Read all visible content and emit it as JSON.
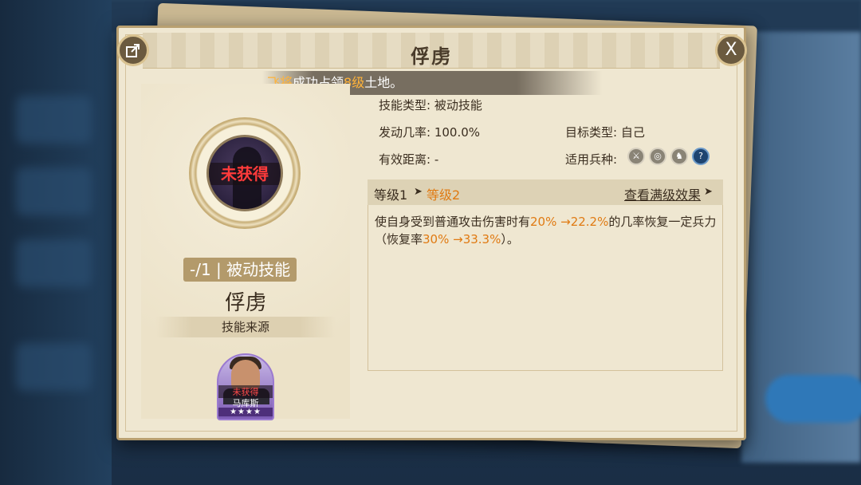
{
  "dialog": {
    "title": "俘虏",
    "share_icon": "share-icon",
    "close_label": "X"
  },
  "toast": {
    "prefix": "飞将",
    "middle": "成功占领",
    "number": "8级",
    "suffix": "土地。"
  },
  "skill": {
    "status": "未获得",
    "tag": "-/1 | 被动技能",
    "name": "俘虏",
    "source_label": "技能来源"
  },
  "hero": {
    "status": "未获得",
    "name": "马库斯",
    "stars": "★★★★"
  },
  "info": {
    "type_label": "技能类型: 被动技能",
    "rate_label": "发动几率: 100.0%",
    "target_label": "目标类型: 自己",
    "range_label": "有效距离: -",
    "troops_label": "适用兵种:",
    "troop_icons": [
      "sword-icon",
      "bow-icon",
      "horse-icon",
      "question-icon"
    ]
  },
  "level": {
    "from": "等级1",
    "arrow": "➤",
    "to": "等级2",
    "max_link": "查看满级效果",
    "max_arrow": "➤"
  },
  "description": {
    "p1": "使自身受到普通攻击伤害时有",
    "v1": "20% →22.2%",
    "p2": "的几率恢复一定兵力（恢复率",
    "v2": "30% →33.3%",
    "p3": "）。"
  },
  "colors": {
    "accent_orange": "#e07a12",
    "unobtained_red": "#ff3b3b",
    "panel_bg": "#efe7d1"
  }
}
